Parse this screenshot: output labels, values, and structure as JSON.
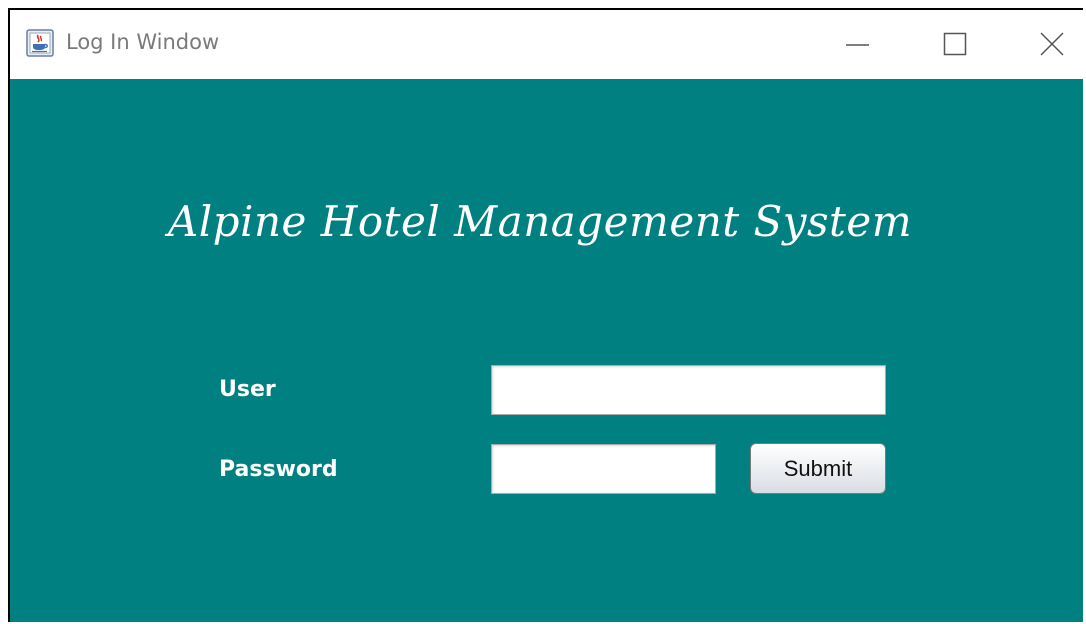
{
  "window": {
    "title": "Log In Window"
  },
  "icons": {
    "app": "java-app-icon",
    "minimize": "minimize-icon",
    "maximize": "maximize-icon",
    "close": "close-icon"
  },
  "form": {
    "heading": "Alpine Hotel Management System",
    "user_label": "User",
    "password_label": "Password",
    "user_value": "",
    "password_value": "",
    "submit_label": "Submit"
  },
  "colors": {
    "background": "#008080",
    "text": "#ffffff",
    "titlebar": "#ffffff"
  }
}
